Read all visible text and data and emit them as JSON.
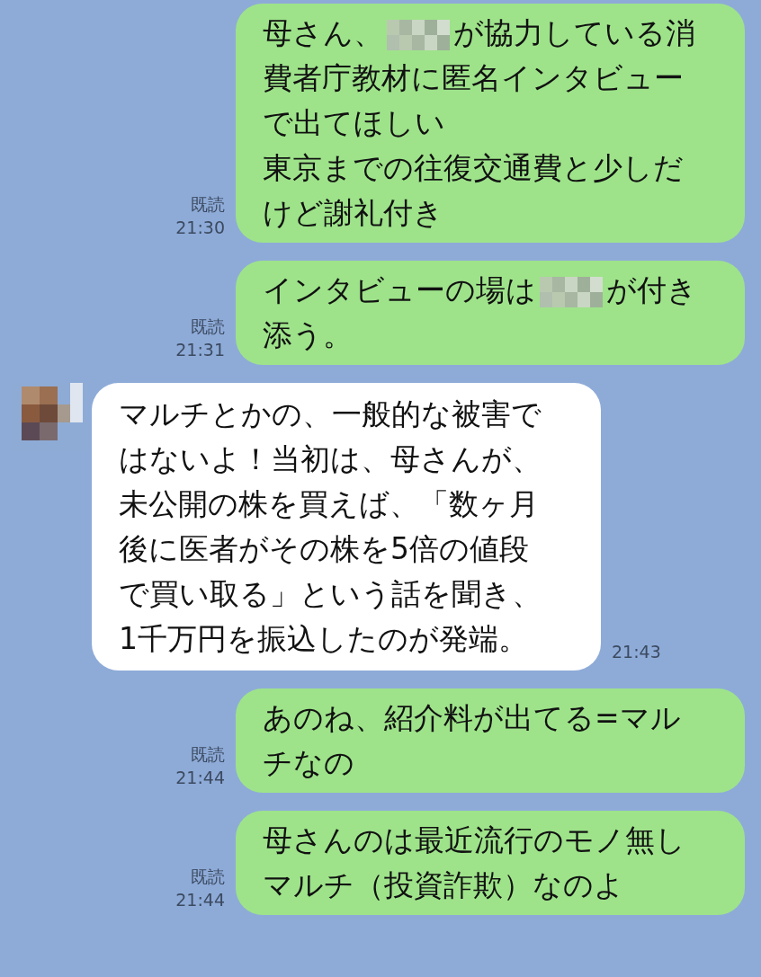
{
  "messages": [
    {
      "kind": "outgoing",
      "read_label": "既読",
      "time": "21:30",
      "lines": [
        [
          {
            "kind": "text",
            "text": "母さん、"
          },
          {
            "kind": "redacted"
          },
          {
            "kind": "text",
            "text": "が協力している消"
          }
        ],
        [
          {
            "kind": "text",
            "text": "費者庁教材に匿名インタビュー"
          }
        ],
        [
          {
            "kind": "text",
            "text": "で出てほしい"
          }
        ],
        [
          {
            "kind": "text",
            "text": "東京までの往復交通費と少しだ"
          }
        ],
        [
          {
            "kind": "text",
            "text": "けど謝礼付き"
          }
        ]
      ]
    },
    {
      "kind": "outgoing",
      "read_label": "既読",
      "time": "21:31",
      "lines": [
        [
          {
            "kind": "text",
            "text": "インタビューの場は"
          },
          {
            "kind": "redacted"
          },
          {
            "kind": "text",
            "text": "が付き"
          }
        ],
        [
          {
            "kind": "text",
            "text": "添う。"
          }
        ]
      ]
    },
    {
      "kind": "incoming",
      "time": "21:43",
      "lines": [
        [
          {
            "kind": "text",
            "text": "マルチとかの、一般的な被害で"
          }
        ],
        [
          {
            "kind": "text",
            "text": "はないよ！当初は、母さんが、"
          }
        ],
        [
          {
            "kind": "text",
            "text": "未公開の株を買えば、「数ヶ月"
          }
        ],
        [
          {
            "kind": "text",
            "text": "後に医者がその株を5倍の値段"
          }
        ],
        [
          {
            "kind": "text",
            "text": "で買い取る」という話を聞き、"
          }
        ],
        [
          {
            "kind": "text",
            "text": "1千万円を振込したのが発端。"
          }
        ]
      ]
    },
    {
      "kind": "outgoing",
      "read_label": "既読",
      "time": "21:44",
      "lines": [
        [
          {
            "kind": "text",
            "text": "あのね、紹介料が出てる=マル"
          }
        ],
        [
          {
            "kind": "text",
            "text": "チなの"
          }
        ]
      ]
    },
    {
      "kind": "outgoing",
      "read_label": "既読",
      "time": "21:44",
      "lines": [
        [
          {
            "kind": "text",
            "text": "母さんのは最近流行のモノ無し"
          }
        ],
        [
          {
            "kind": "text",
            "text": "マルチ（投資詐欺）なのよ"
          }
        ]
      ]
    }
  ]
}
